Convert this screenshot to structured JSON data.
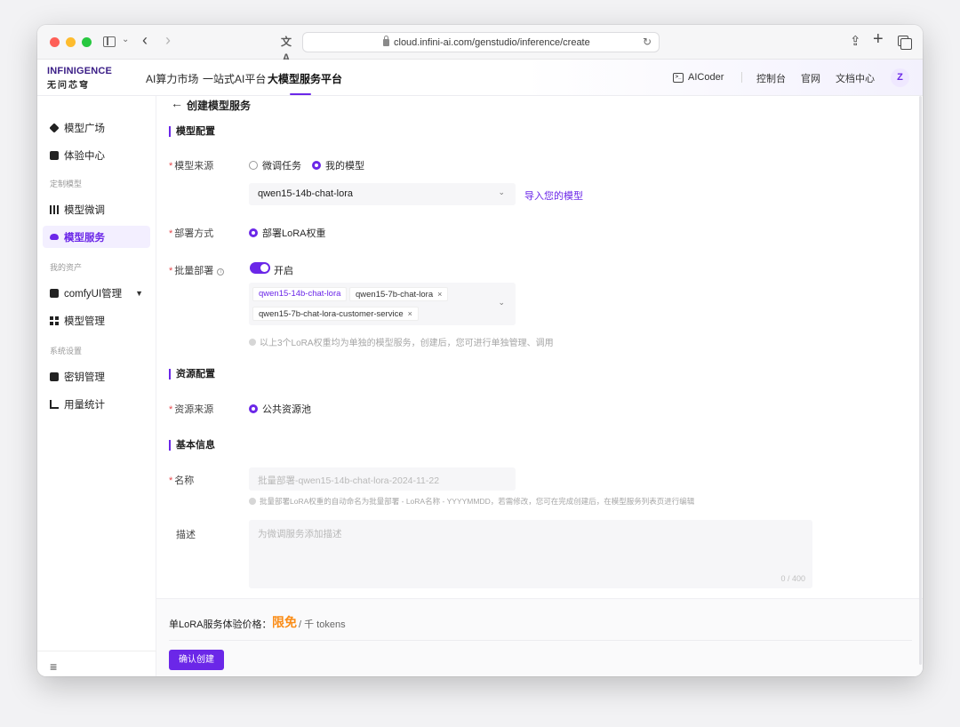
{
  "browser": {
    "url": "cloud.infini-ai.com/genstudio/inference/create"
  },
  "brand": {
    "logo_en": "INFINIGENCE",
    "logo_cn": "无问芯穹",
    "accent": "#6b27e8"
  },
  "topnav": {
    "items": [
      "AI算力市场",
      "一站式AI平台",
      "大模型服务平台"
    ],
    "active_index": 2,
    "aicoder": "AICoder",
    "right": [
      "控制台",
      "官网",
      "文档中心"
    ],
    "avatar": "Z"
  },
  "sidebar": {
    "items": [
      {
        "label": "模型广场",
        "icon": "cube-icon"
      },
      {
        "label": "体验中心",
        "icon": "experience-icon"
      },
      {
        "label": "模型微调",
        "icon": "sliders-icon"
      },
      {
        "label": "模型服务",
        "icon": "cloud-icon",
        "active": true
      },
      {
        "label": "comfyUI管理",
        "icon": "terminal-icon"
      },
      {
        "label": "模型管理",
        "icon": "grid-icon"
      },
      {
        "label": "密钥管理",
        "icon": "key-icon"
      },
      {
        "label": "用量统计",
        "icon": "bar-chart-icon"
      }
    ],
    "sections": [
      "定制模型",
      "我的资产",
      "系统设置"
    ]
  },
  "page": {
    "title": "创建模型服务",
    "model_config": {
      "section": "模型配置",
      "source_label": "模型来源",
      "source_options": [
        "微调任务",
        "我的模型"
      ],
      "source_selected": 1,
      "model_value": "qwen15-14b-chat-lora",
      "import_link": "导入您的模型",
      "deploy_label": "部署方式",
      "deploy_option": "部署LoRA权重",
      "batch_label": "批量部署",
      "batch_toggle_label": "开启",
      "batch_toggle_on": true,
      "tags": [
        "qwen15-14b-chat-lora",
        "qwen15-7b-chat-lora",
        "qwen15-7b-chat-lora-customer-service"
      ],
      "batch_hint": "以上3个LoRA权重均为单独的模型服务，创建后，您可进行单独管理、调用"
    },
    "resource_config": {
      "section": "资源配置",
      "source_label": "资源来源",
      "source_option": "公共资源池"
    },
    "basic_info": {
      "section": "基本信息",
      "name_label": "名称",
      "name_placeholder": "批量部署-qwen15-14b-chat-lora-2024-11-22",
      "name_hint": "批量部署LoRA权重的自动命名为批量部署 - LoRA名称 - YYYYMMDD，若需修改，您可在完成创建后，在模型服务列表页进行编辑",
      "desc_label": "描述",
      "desc_placeholder": "为微调服务添加描述",
      "desc_count": "0 / 400"
    },
    "footer": {
      "price_label": "单LoRA服务体验价格：",
      "price_value": "限免",
      "price_unit": "/ 千 tokens",
      "confirm": "确认创建"
    }
  }
}
